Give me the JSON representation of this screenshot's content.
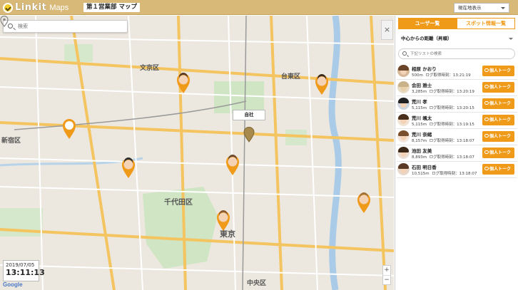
{
  "header": {
    "logo_text": "Linkit",
    "logo_sub": "Maps",
    "page_title": "第１営業部 マップ",
    "view_select": "現在地表示"
  },
  "map": {
    "search_placeholder": "検索",
    "collapse_label": "×",
    "hq_label": "自社",
    "date": "2019/07/05",
    "time": "13:11:13",
    "zoom_in": "+",
    "zoom_out": "−",
    "google_label": "Google",
    "area_labels": {
      "bunkyo": "文京区",
      "taito": "台東区",
      "shinjuku": "新宿区",
      "chiyoda": "千代田区",
      "tokyo": "東京",
      "chuo": "中央区"
    }
  },
  "panel": {
    "tab_users": "ユーザ一覧",
    "tab_spots": "スポット情報一覧",
    "sort_select": "中心からの距離（昇順）",
    "list_search_placeholder": "下記リストの検索",
    "talk_label": "個人トーク",
    "log_prefix": "ログ取得時刻：",
    "users": [
      {
        "name": "相原 かおり",
        "distance": "500m",
        "time": "13:21:19"
      },
      {
        "name": "会田 雅士",
        "distance": "3,285m",
        "time": "13:20:19"
      },
      {
        "name": "荒川 孝",
        "distance": "5,115m",
        "time": "13:20:15"
      },
      {
        "name": "荒川 颯太",
        "distance": "5,115m",
        "time": "13:19:15"
      },
      {
        "name": "荒川 奈緒",
        "distance": "8,157m",
        "time": "13:18:07"
      },
      {
        "name": "池田 友美",
        "distance": "8,893m",
        "time": "13:18:07"
      },
      {
        "name": "石田 明日香",
        "distance": "10,515m",
        "time": "13:18:07"
      }
    ]
  }
}
